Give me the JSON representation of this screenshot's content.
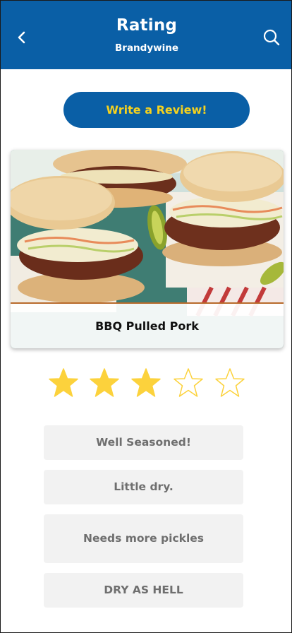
{
  "header": {
    "title": "Rating",
    "subtitle": "Brandywine",
    "back_icon": "chevron-left-icon",
    "search_icon": "search-icon",
    "background_color": "#0a5fa6"
  },
  "write_review": {
    "label": "Write a Review!",
    "text_color": "#f6d21e"
  },
  "dish": {
    "name": "BBQ Pulled Pork",
    "image": "pulled-pork-sandwiches-photo"
  },
  "rating": {
    "value": 3,
    "max": 5,
    "filled_color": "#fcd23c"
  },
  "quick_reviews": [
    "Well Seasoned!",
    "Little dry.",
    "Needs more pickles",
    "DRY AS HELL"
  ]
}
